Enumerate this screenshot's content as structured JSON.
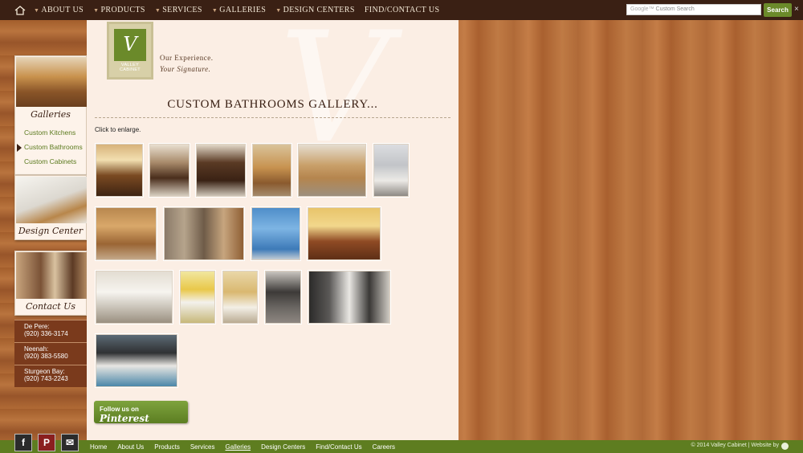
{
  "nav": {
    "items": [
      "About Us",
      "Products",
      "Services",
      "Galleries",
      "Design Centers",
      "Find/Contact Us"
    ],
    "dropdowns": [
      true,
      true,
      true,
      true,
      true,
      false
    ],
    "search_placeholder": "Custom Search",
    "search_brand": "Google™",
    "search_button": "Search",
    "close": "×"
  },
  "sidebar": {
    "galleries_label": "Galleries",
    "gallery_links": [
      "Custom Kitchens",
      "Custom Bathrooms",
      "Custom Cabinets"
    ],
    "active_link": "Custom Bathrooms",
    "design_center_label": "Design Center",
    "contact_label": "Contact Us",
    "phones": [
      {
        "location": "De Pere:",
        "number": "(920) 336-3174"
      },
      {
        "location": "Neenah:",
        "number": "(920) 383-5580"
      },
      {
        "location": "Sturgeon Bay:",
        "number": "(920) 743-2243"
      }
    ]
  },
  "brand": {
    "logo_line1": "VALLEY",
    "logo_line2": "CABINET",
    "logo_mark": "V",
    "tagline1": "Our Experience.",
    "tagline2": "Your Signature."
  },
  "main": {
    "title": "Custom Bathrooms Gallery...",
    "hint": "Click to enlarge.",
    "pinterest_prefix": "Follow us on",
    "pinterest_brand": "Pinterest"
  },
  "footer": {
    "links": [
      "Home",
      "About Us",
      "Products",
      "Services",
      "Galleries",
      "Design Centers",
      "Find/Contact Us",
      "Careers"
    ],
    "current": "Galleries",
    "copyright": "© 2014 Valley Cabinet | Website by"
  },
  "social": [
    "f",
    "P",
    "✉"
  ],
  "colors": {
    "topbar": "#3a2014",
    "accent_green": "#6b8a2a",
    "panel": "#fbeee4",
    "wood": "#b06a38"
  }
}
